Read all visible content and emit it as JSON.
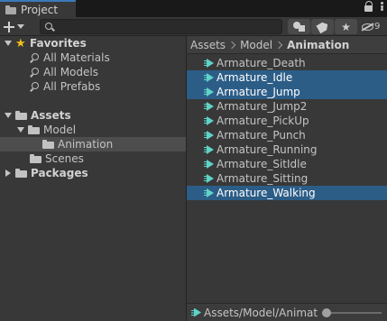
{
  "window": {
    "tab_title": "Project"
  },
  "toolbar": {
    "search": {
      "value": "",
      "placeholder": ""
    },
    "hidden_packages_count": "9"
  },
  "tree": {
    "favorites": {
      "label": "Favorites",
      "items": [
        {
          "label": "All Materials"
        },
        {
          "label": "All Models"
        },
        {
          "label": "All Prefabs"
        }
      ]
    },
    "assets": {
      "label": "Assets",
      "model": {
        "label": "Model",
        "animation": {
          "label": "Animation",
          "selected": true
        }
      },
      "scenes": {
        "label": "Scenes"
      }
    },
    "packages": {
      "label": "Packages"
    }
  },
  "breadcrumb": {
    "items": [
      "Assets",
      "Model",
      "Animation"
    ]
  },
  "files": [
    {
      "name": "Armature_Death",
      "selected": false
    },
    {
      "name": "Armature_Idle",
      "selected": true
    },
    {
      "name": "Armature_Jump",
      "selected": true
    },
    {
      "name": "Armature_Jump2",
      "selected": false
    },
    {
      "name": "Armature_PickUp",
      "selected": false
    },
    {
      "name": "Armature_Punch",
      "selected": false
    },
    {
      "name": "Armature_Running",
      "selected": false
    },
    {
      "name": "Armature_SitIdle",
      "selected": false
    },
    {
      "name": "Armature_Sitting",
      "selected": false
    },
    {
      "name": "Armature_Walking",
      "selected": true
    }
  ],
  "statusbar": {
    "path": "Assets/Model/Animatio",
    "zoom_level": 0
  },
  "colors": {
    "selection": "#2c5d87",
    "tab_accent": "#3a79bb",
    "anim_icon": "#5fd3c8",
    "favorite_star": "#f2c019"
  }
}
